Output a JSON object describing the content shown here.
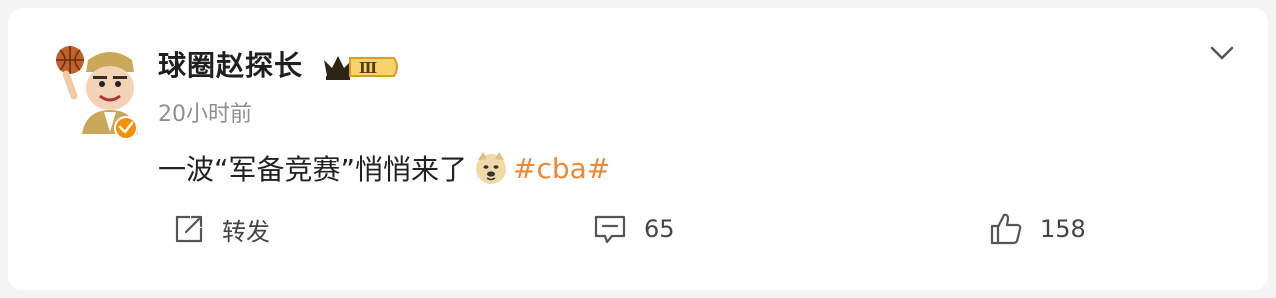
{
  "user": {
    "name": "球圈赵探长",
    "vip_level": "Ⅲ"
  },
  "post": {
    "time": "20小时前",
    "text": "一波“军备竞赛”悄悄来了",
    "emoji": "doge-emoji",
    "hashtag": "#cba#"
  },
  "actions": {
    "repost_label": "转发",
    "comment_count": "65",
    "like_count": "158"
  },
  "colors": {
    "hashtag": "#e98a3a",
    "verified_badge": "#f29100",
    "vip_gold": "#d99a2b"
  }
}
